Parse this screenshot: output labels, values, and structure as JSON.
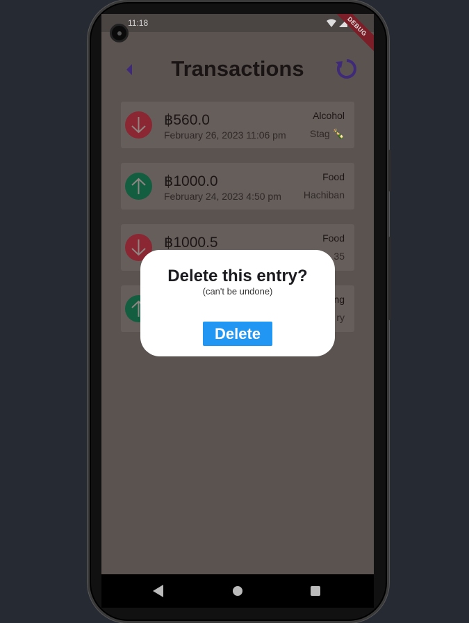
{
  "status": {
    "time": "11:18"
  },
  "debug_label": "DEBUG",
  "header": {
    "title": "Transactions",
    "back_icon": "caret-left-icon",
    "refresh_icon": "refresh-icon",
    "accent": "#5b35b5"
  },
  "transactions": [
    {
      "direction": "down",
      "amount": "฿560.0",
      "date": "February 26, 2023 11:06 pm",
      "category": "Alcohol",
      "note": "Stag 🍾"
    },
    {
      "direction": "up",
      "amount": "฿1000.0",
      "date": "February 24, 2023 4:50 pm",
      "category": "Food",
      "note": "Hachiban"
    },
    {
      "direction": "down",
      "amount": "฿1000.5",
      "date": "",
      "category": "Food",
      "note": "35"
    },
    {
      "direction": "up",
      "amount": "",
      "date": "",
      "category": "ng",
      "note": "ry"
    }
  ],
  "dialog": {
    "title": "Delete this entry?",
    "subtitle": "(can't be undone)",
    "delete_label": "Delete",
    "accent": "#2196f3"
  },
  "colors": {
    "expense": "#d0313f",
    "income": "#1a8a5e"
  }
}
